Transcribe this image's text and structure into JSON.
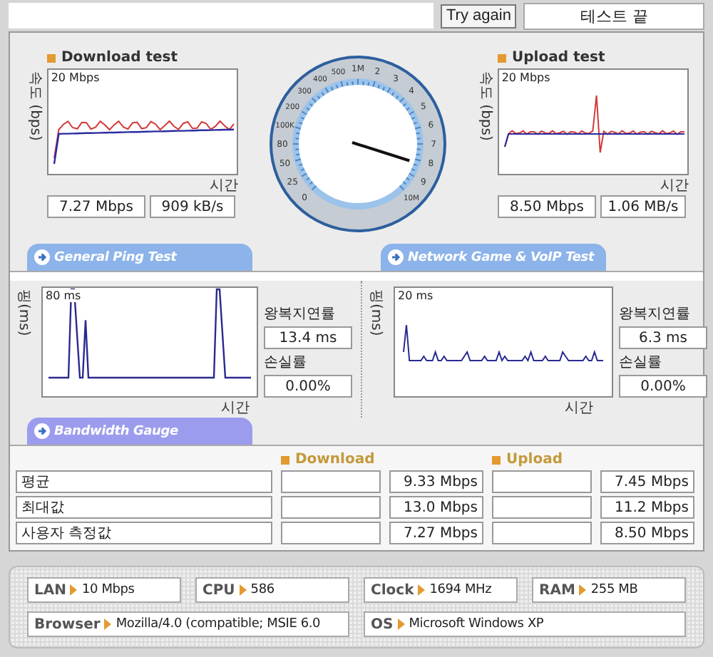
{
  "header": {
    "button": "Try again",
    "status": "테스트 끝"
  },
  "download": {
    "title": "Download test",
    "axis": "속도 (bps)",
    "scale": "20 Mbps",
    "time_label": "시간",
    "rate": "7.27 Mbps",
    "bytes": "909 kB/s"
  },
  "gauge": {
    "level": 0.9,
    "dial_labels": [
      "1M",
      "500",
      "2",
      "400",
      "3",
      "300",
      "4",
      "200",
      "5",
      "100K",
      "6",
      "80",
      "7",
      "50",
      "8",
      "25",
      "9",
      "0",
      "10M"
    ]
  },
  "upload": {
    "title": "Upload test",
    "axis": "속도 (bps)",
    "scale": "20 Mbps",
    "time_label": "시간",
    "rate": "8.50 Mbps",
    "bytes": "1.06 MB/s"
  },
  "ping_tests": [
    {
      "tab": "General Ping Test",
      "axis": "핑(ms)",
      "scale": "80 ms",
      "time_label": "시간",
      "latency_label": "왕복지연률",
      "latency": "13.4 ms",
      "loss_label": "손실률",
      "loss": "0.00%"
    },
    {
      "tab": "Network Game & VoIP Test",
      "axis": "핑(ms)",
      "scale": "20 ms",
      "time_label": "시간",
      "latency_label": "왕복지연률",
      "latency": "6.3 ms",
      "loss_label": "손실률",
      "loss": "0.00%"
    }
  ],
  "bandwidth": {
    "tab": "Bandwidth Gauge",
    "columns": [
      "Download",
      "Upload"
    ],
    "rows": [
      {
        "label": "평균",
        "download": "9.33 Mbps",
        "upload": "7.45 Mbps"
      },
      {
        "label": "최대값",
        "download": "13.0 Mbps",
        "upload": "11.2 Mbps"
      },
      {
        "label": "사용자 측정값",
        "download": "7.27 Mbps",
        "upload": "8.50 Mbps"
      }
    ]
  },
  "system": [
    {
      "label": "LAN",
      "value": "10 Mbps"
    },
    {
      "label": "CPU",
      "value": "586"
    },
    {
      "label": "Clock",
      "value": "1694 MHz"
    },
    {
      "label": "RAM",
      "value": "255 MB"
    },
    {
      "label": "Browser",
      "value": "Mozilla/4.0 (compatible; MSIE 6.0"
    },
    {
      "label": "OS",
      "value": "Microsoft Windows XP"
    }
  ]
}
